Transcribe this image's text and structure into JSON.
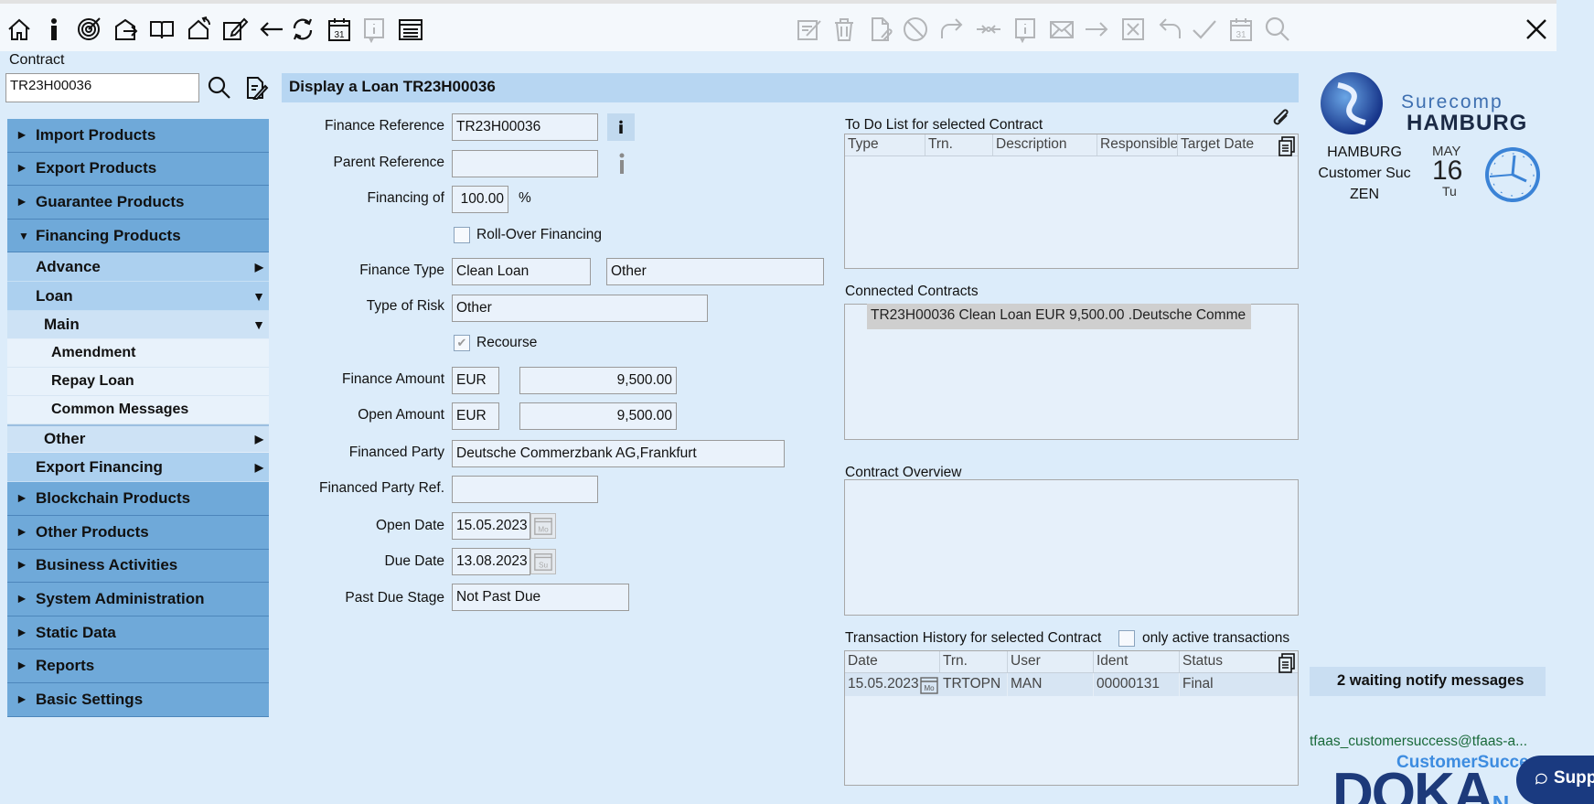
{
  "toolbar": {
    "left_icons": [
      "home-icon",
      "info-icon",
      "target-icon",
      "export-icon",
      "book-icon",
      "route-icon",
      "edit-icon",
      "back-arrow-icon",
      "refresh-icon",
      "calendar-icon",
      "info-disabled-icon",
      "list-icon"
    ],
    "right_icons": [
      "sign-icon",
      "trash-icon",
      "attach-doc-icon",
      "block-icon",
      "forward-icon",
      "swap-icon",
      "info-box-icon",
      "mail-icon",
      "arrow-right-icon",
      "cancel-box-icon",
      "undo-icon",
      "check-icon",
      "calendar-icon",
      "search-icon"
    ],
    "calendar_day": "31"
  },
  "contract": {
    "label": "Contract",
    "value": "TR23H00036"
  },
  "nav": {
    "import_products": "Import Products",
    "export_products": "Export Products",
    "guarantee_products": "Guarantee Products",
    "financing_products": "Financing Products",
    "advance": "Advance",
    "loan": "Loan",
    "main": "Main",
    "amendment": "Amendment",
    "repay_loan": "Repay Loan",
    "common_messages": "Common Messages",
    "other": "Other",
    "export_financing": "Export Financing",
    "blockchain_products": "Blockchain Products",
    "other_products": "Other Products",
    "business_activities": "Business Activities",
    "system_administration": "System Administration",
    "static_data": "Static Data",
    "reports": "Reports",
    "basic_settings": "Basic Settings"
  },
  "title": "Display a Loan TR23H00036",
  "form": {
    "finance_reference_label": "Finance Reference",
    "finance_reference": "TR23H00036",
    "parent_reference_label": "Parent Reference",
    "parent_reference": "",
    "financing_of_label": "Financing of",
    "financing_of": "100.00",
    "percent": "%",
    "rollover_label": "Roll-Over Financing",
    "finance_type_label": "Finance Type",
    "finance_type": "Clean Loan",
    "finance_type_2": "Other",
    "type_of_risk_label": "Type of Risk",
    "type_of_risk": "Other",
    "recourse_label": "Recourse",
    "finance_amount_label": "Finance Amount",
    "finance_amount_ccy": "EUR",
    "finance_amount": "9,500.00",
    "open_amount_label": "Open Amount",
    "open_amount_ccy": "EUR",
    "open_amount": "9,500.00",
    "financed_party_label": "Financed Party",
    "financed_party": "Deutsche Commerzbank AG,Frankfurt",
    "financed_party_ref_label": "Financed Party Ref.",
    "financed_party_ref": "",
    "open_date_label": "Open Date",
    "open_date": "15.05.2023",
    "open_date_cal": "Mo",
    "due_date_label": "Due Date",
    "due_date": "13.08.2023",
    "due_date_cal": "Su",
    "past_due_stage_label": "Past Due Stage",
    "past_due_stage": "Not Past Due"
  },
  "todo": {
    "label": "To Do List for selected Contract",
    "columns": [
      "Type",
      "Trn.",
      "Description",
      "Responsible",
      "Target Date"
    ]
  },
  "connected": {
    "label": "Connected Contracts",
    "item": "TR23H00036 Clean Loan EUR 9,500.00 .Deutsche Comme"
  },
  "overview": {
    "label": "Contract Overview"
  },
  "history": {
    "label": "Transaction History for selected Contract",
    "only_active_label": "only active transactions",
    "columns": [
      "Date",
      "Trn.",
      "User",
      "Ident",
      "Status"
    ],
    "row": {
      "date": "15.05.2023",
      "cal": "Mo",
      "trn": "TRTOPN",
      "user": "MAN",
      "ident": "00000131",
      "status": "Final"
    }
  },
  "sidebar": {
    "brand1": "Surecomp",
    "brand2": "HAMBURG",
    "city": "HAMBURG",
    "unit": "Customer Suc",
    "user": "ZEN",
    "month": "MAY",
    "day": "16",
    "weekday": "Tu",
    "notify": "2 waiting notify messages",
    "email": "tfaas_customersuccess@tfaas-a...",
    "doka_title": "CustomerSucce",
    "doka_logo": "DOKA",
    "doka_suffix": "N",
    "support": "Suppo"
  },
  "colors": {
    "accent": "#6fa9d9",
    "background": "#dcecfa",
    "title_bar": "#b7d6f2"
  }
}
